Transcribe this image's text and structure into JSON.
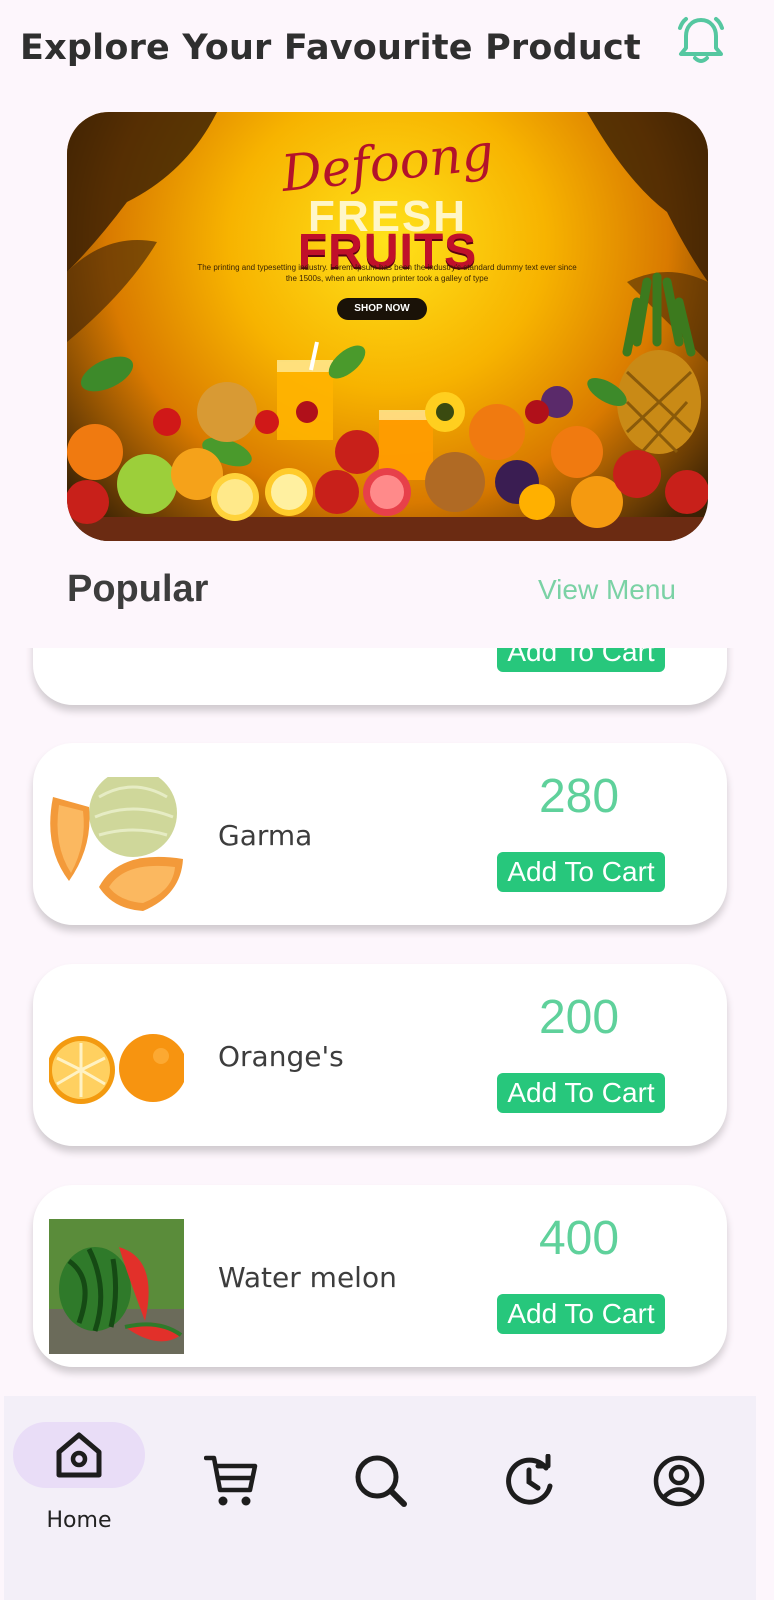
{
  "header": {
    "title": "Explore Your Favourite Product",
    "notification_icon": "bell-icon",
    "accent_color": "#55c7a0"
  },
  "banner": {
    "brand": "Defoong",
    "headline": "FRESH",
    "subheadline": "FRUITS",
    "description": "The printing and typesetting industry. Lorem Ipsum has been the industry's standard dummy text ever since the 1500s, when an unknown printer took a galley of type",
    "cta": "SHOP NOW"
  },
  "popular": {
    "title": "Popular",
    "view_menu": "View Menu",
    "items": [
      {
        "name": "",
        "price": "",
        "button": "Add To Cart",
        "image": "orange-slice"
      },
      {
        "name": "Garma",
        "price": "280",
        "button": "Add To Cart",
        "image": "melon"
      },
      {
        "name": "Orange's",
        "price": "200",
        "button": "Add To Cart",
        "image": "orange"
      },
      {
        "name": "Water melon",
        "price": "400",
        "button": "Add To Cart",
        "image": "watermelon"
      }
    ]
  },
  "nav": {
    "items": [
      {
        "label": "Home",
        "icon": "home-icon",
        "active": true
      },
      {
        "label": "",
        "icon": "cart-icon",
        "active": false
      },
      {
        "label": "",
        "icon": "search-icon",
        "active": false
      },
      {
        "label": "",
        "icon": "history-icon",
        "active": false
      },
      {
        "label": "",
        "icon": "profile-icon",
        "active": false
      }
    ]
  }
}
